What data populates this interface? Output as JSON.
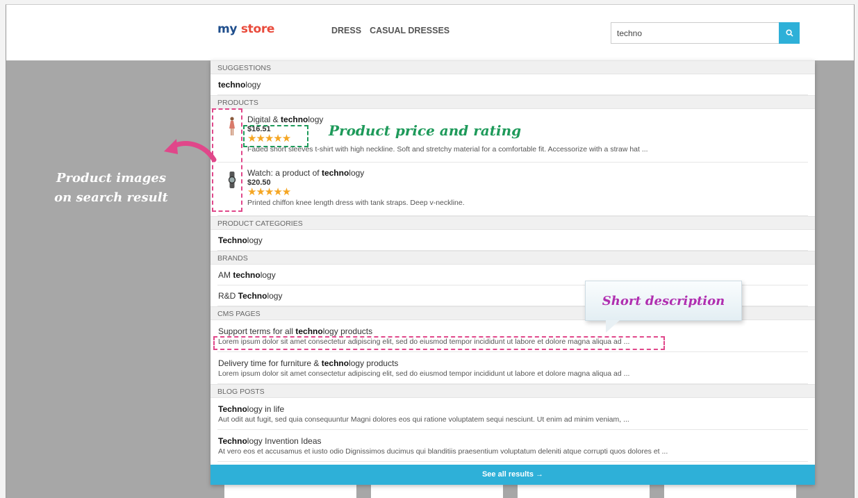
{
  "header": {
    "logo_part1": "my",
    "logo_part2": "store",
    "nav": [
      "DRESS",
      "CASUAL DRESSES"
    ],
    "search_value": "techno",
    "search_icon": "search-icon"
  },
  "dropdown": {
    "suggestions": {
      "heading": "SUGGESTIONS",
      "items": [
        {
          "bold": "techno",
          "rest": "logy"
        }
      ]
    },
    "products": {
      "heading": "PRODUCTS",
      "items": [
        {
          "pre": "Digital & ",
          "bold": "techno",
          "rest": "logy",
          "price": "$16.51",
          "rating": 5,
          "stars": "★★★★★",
          "desc": "Faded short sleeves t-shirt with high neckline. Soft and stretchy material for a comfortable fit. Accessorize with a straw hat ..."
        },
        {
          "pre": "Watch: a product of ",
          "bold": "techno",
          "rest": "logy",
          "price": "$20.50",
          "rating": 5,
          "stars": "★★★★★",
          "desc": "Printed chiffon knee length dress with tank straps. Deep v-neckline."
        }
      ]
    },
    "categories": {
      "heading": "PRODUCT CATEGORIES",
      "items": [
        {
          "pre": "",
          "bold": "Techno",
          "rest": "logy"
        }
      ]
    },
    "brands": {
      "heading": "BRANDS",
      "items": [
        {
          "pre": "AM ",
          "bold": "techno",
          "rest": "logy"
        },
        {
          "pre": "R&D ",
          "bold": "Techno",
          "rest": "logy"
        }
      ]
    },
    "cms": {
      "heading": "CMS PAGES",
      "items": [
        {
          "pre": "Support terms for all ",
          "bold": "techno",
          "rest": "logy products",
          "desc": "Lorem ipsum dolor sit amet consectetur adipiscing elit, sed do eiusmod tempor incididunt ut labore et dolore magna aliqua ad ..."
        },
        {
          "pre": "Delivery time for furniture & ",
          "bold": "techno",
          "rest": "logy products",
          "desc": "Lorem ipsum dolor sit amet consectetur adipiscing elit, sed do eiusmod tempor incididunt ut labore et dolore magna aliqua ad ..."
        }
      ]
    },
    "blog": {
      "heading": "BLOG POSTS",
      "items": [
        {
          "pre": "",
          "bold": "Techno",
          "rest": "logy in life",
          "desc": "Aut odit aut fugit, sed quia consequuntur Magni dolores eos qui ratione voluptatem sequi nesciunt. Ut enim ad minim veniam, ..."
        },
        {
          "pre": "",
          "bold": "Techno",
          "rest": "logy Invention Ideas",
          "desc": "At vero eos et accusamus et iusto odio Dignissimos ducimus qui blanditiis praesentium voluptatum deleniti atque corrupti quos dolores et ..."
        }
      ]
    },
    "see_all": "See all results →"
  },
  "annotations": {
    "price_rating": "Product price and rating",
    "images_line1": "Product images",
    "images_line2": "on search result",
    "short_desc": "Short description"
  },
  "colors": {
    "accent": "#2eb0d8",
    "annotation_green": "#1e9a5a",
    "annotation_pink": "#e0478a",
    "annotation_purple": "#b02fb0",
    "star": "#f5a623"
  }
}
